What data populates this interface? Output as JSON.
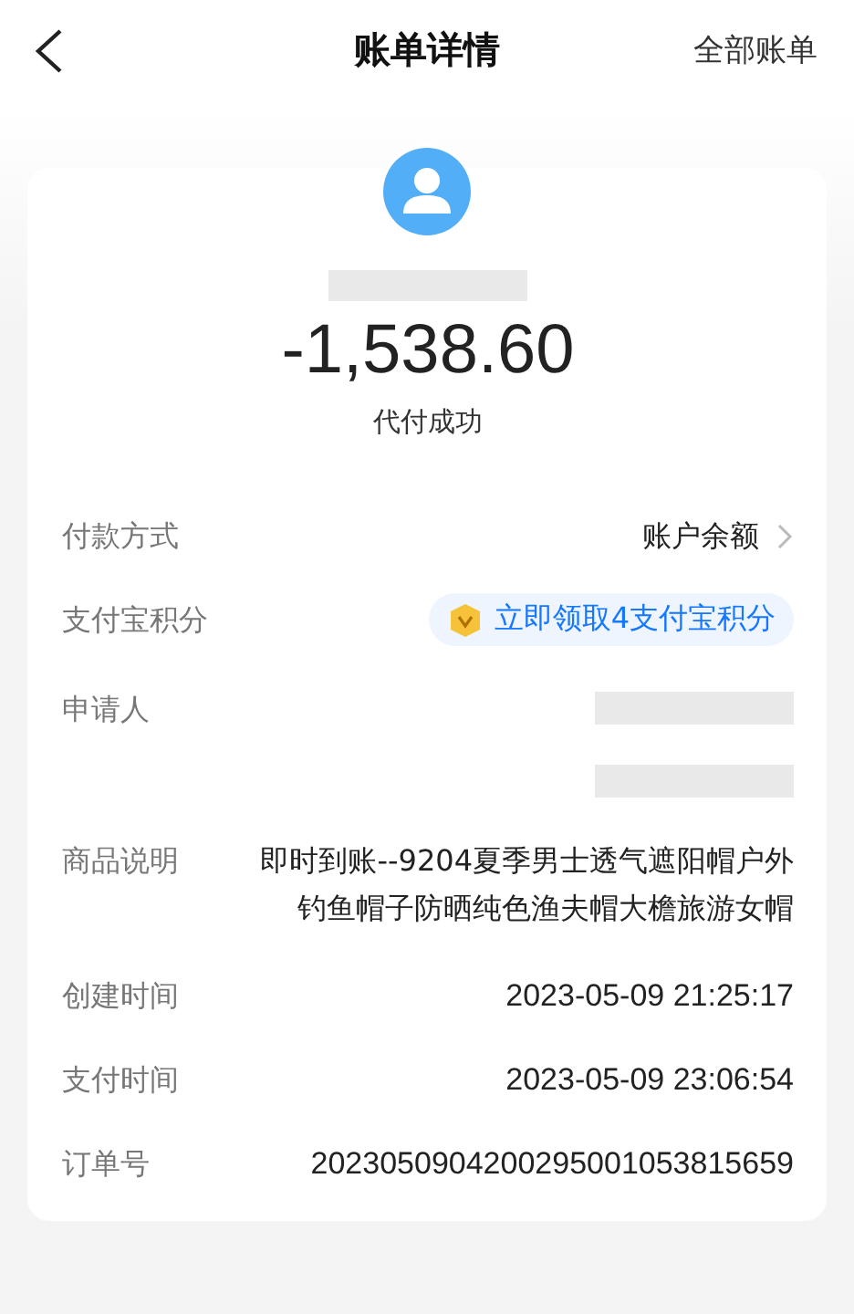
{
  "header": {
    "title": "账单详情",
    "action": "全部账单"
  },
  "summary": {
    "amount": "-1,538.60",
    "status": "代付成功"
  },
  "rows": [
    {
      "kind": "link",
      "label": "付款方式",
      "value": "账户余额"
    },
    {
      "kind": "badge",
      "label": "支付宝积分",
      "value": "立即领取4支付宝积分"
    },
    {
      "kind": "redacted",
      "label": "申请人"
    },
    {
      "kind": "text",
      "label": "商品说明",
      "value": "即时到账--9204夏季男士透气遮阳帽户外钓鱼帽子防晒纯色渔夫帽大檐旅游女帽"
    },
    {
      "kind": "plain",
      "label": "创建时间",
      "value": "2023-05-09 21:25:17"
    },
    {
      "kind": "plain",
      "label": "支付时间",
      "value": "2023-05-09 23:06:54"
    },
    {
      "kind": "plain",
      "label": "订单号",
      "value": "2023050904200295001053815659"
    }
  ]
}
